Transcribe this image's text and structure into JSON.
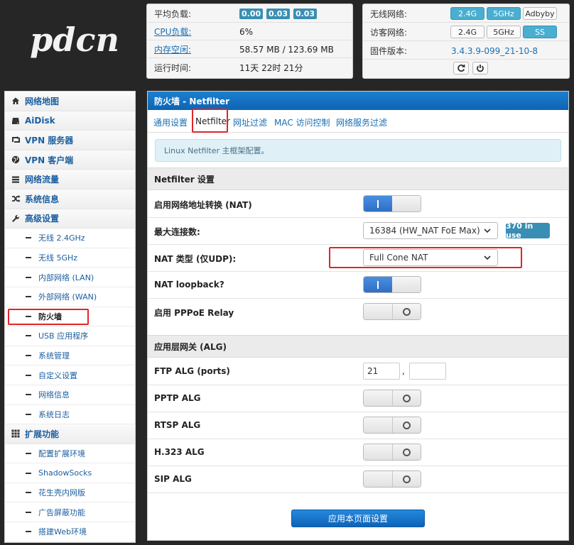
{
  "logo": {
    "text": "pdcn"
  },
  "status_left": {
    "rows": [
      {
        "label": "平均负载:",
        "badges": [
          "0.00",
          "0.03",
          "0.03"
        ]
      },
      {
        "label": "CPU负载:",
        "value": "6%"
      },
      {
        "label": "内存空闲:",
        "value": "58.57 MB / 123.69 MB"
      },
      {
        "label": "运行时间:",
        "value": "11天 22时 21分"
      }
    ]
  },
  "status_right": {
    "wireless_label": "无线网络:",
    "wireless_buttons": [
      "2.4G",
      "5GHz",
      "Adbyby"
    ],
    "guest_label": "访客网络:",
    "guest_buttons": [
      "2.4G",
      "5GHz",
      "SS"
    ],
    "firmware_label": "固件版本:",
    "firmware_value": "3.4.3.9-099_21-10-8"
  },
  "sidebar": {
    "items": [
      {
        "label": "网络地图",
        "icon": "home-icon",
        "type": "main"
      },
      {
        "label": "AiDisk",
        "icon": "hdd-icon",
        "type": "main"
      },
      {
        "label": "VPN 服务器",
        "icon": "retweet-icon",
        "type": "main"
      },
      {
        "label": "VPN 客户端",
        "icon": "globe-icon",
        "type": "main"
      },
      {
        "label": "网络流量",
        "icon": "tasks-icon",
        "type": "main"
      },
      {
        "label": "系统信息",
        "icon": "random-icon",
        "type": "main"
      },
      {
        "label": "高级设置",
        "icon": "wrench-icon",
        "type": "main"
      },
      {
        "label": "无线 2.4GHz",
        "type": "sub"
      },
      {
        "label": "无线 5GHz",
        "type": "sub"
      },
      {
        "label": "内部网络 (LAN)",
        "type": "sub"
      },
      {
        "label": "外部网络 (WAN)",
        "type": "sub"
      },
      {
        "label": "防火墙",
        "type": "sub",
        "active": true
      },
      {
        "label": "USB 应用程序",
        "type": "sub"
      },
      {
        "label": "系统管理",
        "type": "sub"
      },
      {
        "label": "自定义设置",
        "type": "sub"
      },
      {
        "label": "网络信息",
        "type": "sub"
      },
      {
        "label": "系统日志",
        "type": "sub"
      },
      {
        "label": "扩展功能",
        "icon": "th-icon",
        "type": "main"
      },
      {
        "label": "配置扩展环境",
        "type": "sub"
      },
      {
        "label": "ShadowSocks",
        "type": "sub"
      },
      {
        "label": "花生壳内网版",
        "type": "sub"
      },
      {
        "label": "广告屏蔽功能",
        "type": "sub"
      },
      {
        "label": "搭建Web环境",
        "type": "sub"
      }
    ]
  },
  "main": {
    "title": "防火墙 - Netfilter",
    "tabs": [
      {
        "label": "通用设置"
      },
      {
        "label": "Netfilter",
        "active": true
      },
      {
        "label": "网址过滤"
      },
      {
        "label": "MAC 访问控制"
      },
      {
        "label": "网络服务过滤"
      }
    ],
    "info": "Linux Netfilter 主框架配置。",
    "section_netfilter": "Netfilter 设置",
    "nat_label": "启用网络地址转换 (NAT)",
    "nat_on": true,
    "maxconn_label": "最大连接数:",
    "maxconn_value": "16384 (HW_NAT FoE Max)",
    "maxconn_badge": "370 in use",
    "nattype_label": "NAT 类型 (仅UDP):",
    "nattype_value": "Full Cone NAT",
    "loopback_label": "NAT loopback?",
    "loopback_on": true,
    "pppoe_label": "启用 PPPoE Relay",
    "pppoe_on": false,
    "section_alg": "应用层网关 (ALG)",
    "ftp_label": "FTP ALG (ports)",
    "ftp_port1": "21",
    "ftp_sep": ",",
    "ftp_port2": "",
    "pptp_label": "PPTP ALG",
    "rtsp_label": "RTSP ALG",
    "h323_label": "H.323 ALG",
    "sip_label": "SIP ALG",
    "apply_label": "应用本页面设置"
  },
  "colors": {
    "accent": "#0e64b3",
    "badge": "#3a8eb4",
    "highlight": "#e0252a",
    "toggle_on": "#2f6fc4"
  }
}
